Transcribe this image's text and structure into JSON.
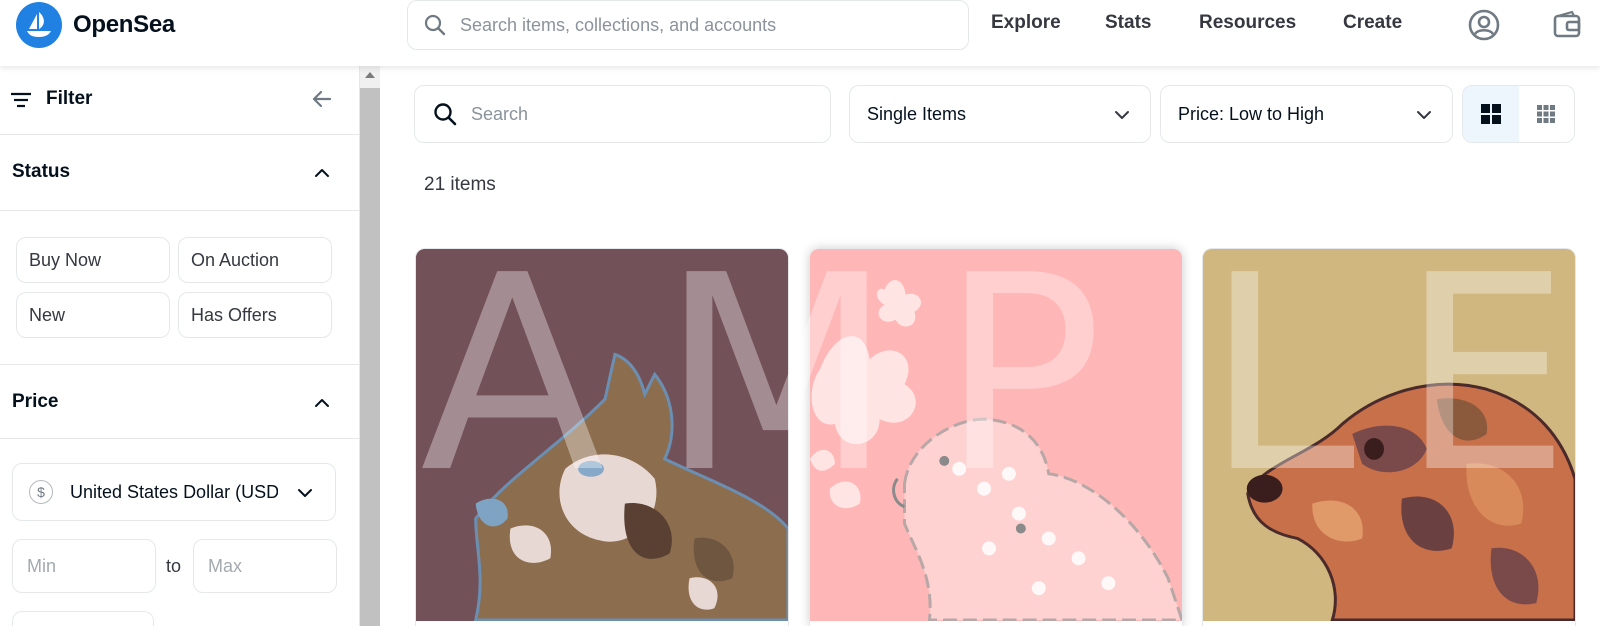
{
  "brand": {
    "name": "OpenSea",
    "accent": "#2081e2",
    "logo_icon": "opensea-sailboat-icon"
  },
  "top_search": {
    "placeholder": "Search items, collections, and accounts",
    "value": ""
  },
  "nav": {
    "explore": "Explore",
    "stats": "Stats",
    "resources": "Resources",
    "create": "Create",
    "account_icon": "account-icon",
    "wallet_icon": "wallet-icon"
  },
  "sidebar": {
    "filter_label": "Filter",
    "status": {
      "title": "Status",
      "buttons": [
        "Buy Now",
        "On Auction",
        "New",
        "Has Offers"
      ]
    },
    "price": {
      "title": "Price",
      "currency": "United States Dollar (USD)",
      "min_placeholder": "Min",
      "max_placeholder": "Max",
      "to_label": "to"
    }
  },
  "main": {
    "search_placeholder": "Search",
    "items_dropdown": "Single Items",
    "sort_dropdown": "Price: Low to High",
    "item_count": "21 items",
    "view_modes": [
      "large-grid-icon",
      "small-grid-icon"
    ],
    "cards": [
      {
        "background": "#735158",
        "art": "camouflage dog head facing left"
      },
      {
        "background": "#ffb6b6",
        "art": "pink hearts-pattern dog with flowers"
      },
      {
        "background": "#d0b67f",
        "art": "orange camouflage dog head facing left"
      }
    ],
    "watermark_letters": [
      "A",
      "M",
      "P",
      "L",
      "E"
    ]
  }
}
